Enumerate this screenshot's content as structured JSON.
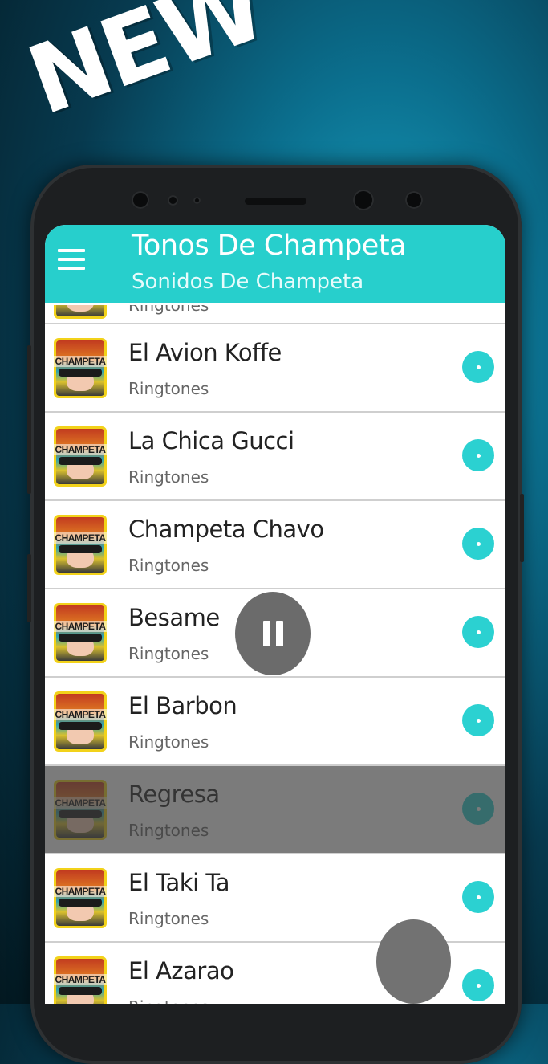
{
  "promo": {
    "badge": "NEW"
  },
  "app_bar": {
    "title": "Tonos De Champeta",
    "subtitle": "Sonidos De Champeta"
  },
  "thumbnail_label": "CHAMPETA",
  "partial_item": {
    "subtitle": "Ringtones"
  },
  "items": [
    {
      "title": "El Avion Koffe",
      "subtitle": "Ringtones"
    },
    {
      "title": "La Chica Gucci",
      "subtitle": "Ringtones"
    },
    {
      "title": "Champeta Chavo",
      "subtitle": "Ringtones"
    },
    {
      "title": "Besame",
      "subtitle": "Ringtones"
    },
    {
      "title": "El Barbon",
      "subtitle": "Ringtones"
    },
    {
      "title": "Regresa",
      "subtitle": "Ringtones",
      "selected": true
    },
    {
      "title": "El Taki Ta",
      "subtitle": "Ringtones"
    },
    {
      "title": "El Azarao",
      "subtitle": "Ringtones"
    }
  ],
  "colors": {
    "accent": "#27cfcc",
    "play": "#2bd1d1",
    "fab": "#6b6b6b"
  },
  "icons": {
    "menu": "hamburger-menu-icon",
    "play": "play-circle-icon",
    "pause": "pause-icon"
  }
}
